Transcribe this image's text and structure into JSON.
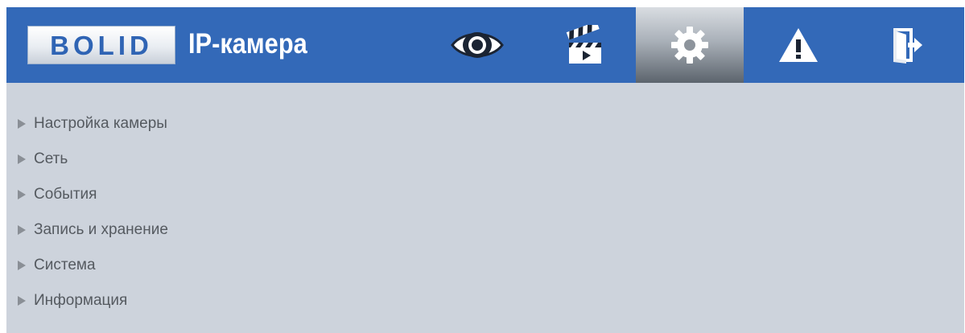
{
  "header": {
    "logo_text": "BOLID",
    "product_title": "IP-камера",
    "accent_color": "#3369b8"
  },
  "nav": [
    {
      "icon": "eye-icon",
      "name": "live-view",
      "active": false
    },
    {
      "icon": "clapperboard-icon",
      "name": "playback",
      "active": false
    },
    {
      "icon": "gear-icon",
      "name": "settings",
      "active": true
    },
    {
      "icon": "warning-icon",
      "name": "alarms",
      "active": false
    },
    {
      "icon": "exit-icon",
      "name": "logout",
      "active": false
    }
  ],
  "menu": {
    "items": [
      {
        "label": "Настройка камеры"
      },
      {
        "label": "Сеть"
      },
      {
        "label": "События"
      },
      {
        "label": "Запись и хранение"
      },
      {
        "label": "Система"
      },
      {
        "label": "Информация"
      }
    ]
  }
}
